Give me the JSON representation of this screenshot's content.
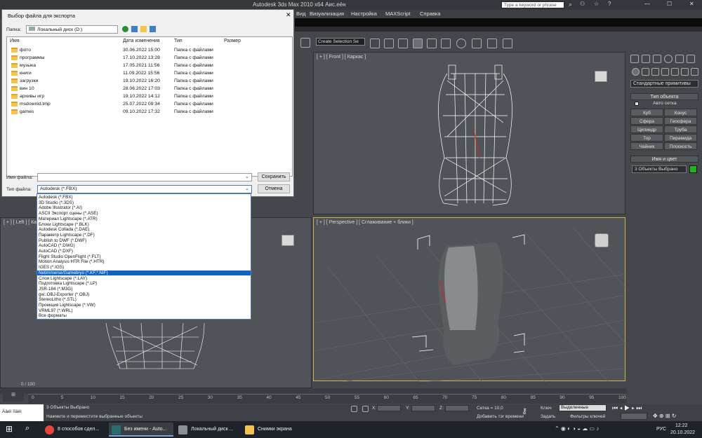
{
  "app": {
    "title": "Autodesk 3ds Max  2010 x64    Аис.еён",
    "search_placeholder": "Type a keyword or phrase",
    "menu": [
      "Вид",
      "Визуализация",
      "Настройка",
      "MAXScript",
      "Справка"
    ],
    "win_controls": [
      "—",
      "☐",
      "✕"
    ]
  },
  "toolbar": {
    "selection_set": "Create Selection Se"
  },
  "viewports": {
    "front": "[ + ] [ Front ] [ Каркас ]",
    "left": "[ + ] [ Left ] [ Кар",
    "perspective": "[ + ] [ Perspective ] [ Сглаживание + блики ]"
  },
  "command_panel": {
    "dropdown": "Стандартные примитивы",
    "object_type_header": "Тип объекта",
    "autogrid_label": "Авто сетка",
    "buttons": [
      "Куб",
      "Конус",
      "Сфера",
      "Геосфера",
      "Цилиндр",
      "Труба",
      "Тор",
      "Пирамида",
      "Чайник",
      "Плоскость"
    ],
    "name_color_header": "Имя и цвет",
    "name_value": "3 Объекты Выбрано",
    "object_color": "#1db41d"
  },
  "dialog": {
    "title": "Выбор файла для экспорта",
    "close": "✕",
    "folder_label": "Папка:",
    "folder_value": "Локальный диск (D:)",
    "columns": [
      "Имя",
      "Дата изменения",
      "Тип",
      "Размер"
    ],
    "files": [
      {
        "name": "фото",
        "date": "30.06.2022 15:00",
        "type": "Папка с файлами"
      },
      {
        "name": "программы",
        "date": "17.10.2022 13:28",
        "type": "Папка с файлами"
      },
      {
        "name": "музыка",
        "date": "17.05.2021 11:56",
        "type": "Папка с файлами"
      },
      {
        "name": "книги",
        "date": "11.09.2022 15:56",
        "type": "Папка с файлами"
      },
      {
        "name": "загрузки",
        "date": "19.10.2022 16:20",
        "type": "Папка с файлами"
      },
      {
        "name": "вин 10",
        "date": "28.06.2022 17:03",
        "type": "Папка с файлами"
      },
      {
        "name": "архивы игр",
        "date": "19.10.2022 14:12",
        "type": "Папка с файлами"
      },
      {
        "name": "msdownld.tmp",
        "date": "25.07.2022 09:34",
        "type": "Папка с файлами"
      },
      {
        "name": "games",
        "date": "09.10.2022 17:32",
        "type": "Папка с файлами"
      }
    ],
    "filename_label": "Имя файла:",
    "filetype_label": "Тип файла:",
    "filetype_value": "Autodesk (*.FBX)",
    "save_button": "Сохранить",
    "cancel_button": "Отмена",
    "filetype_options": [
      "Autodesk (*.FBX)",
      "3D Studio (*.3DS)",
      "Adobe Illustrator (*.AI)",
      "ASCII Экспорт сцены (*.ASE)",
      "Материал Lightscape (*.ATR)",
      "Блоки Lightscape (*.BLK)",
      "Autodesk Collada (*.DAE)",
      "Параметр Lightscape (*.DF)",
      "Publish to DWF (*.DWF)",
      "AutoCAD (*.DWG)",
      "AutoCAD (*.DXF)",
      "Flight Studio OpenFlight (*.FLT)",
      "Motion Analysis HTR File (*.HTR)",
      "IGES (*.IGS)",
      "Netimmerse/Gamebryo (*.KF,*.NIF)",
      "Слои Lightscape (*.LAY)",
      "Подготовка Lightscape (*.LP)",
      "JSR-184 (*.M3G)",
      "gw::OBJ-Exporter (*.OBJ)",
      "StereoLitho (*.STL)",
      "Проекция Lightscape (*.VW)",
      "VRML97 (*.WRL)",
      "Все форматы"
    ],
    "selected_option_index": 14
  },
  "timeline": {
    "frame_display": "0 / 100",
    "ticks": [
      "0",
      "5",
      "10",
      "15",
      "20",
      "25",
      "30",
      "35",
      "40",
      "45",
      "50",
      "55",
      "60",
      "65",
      "70",
      "75",
      "80",
      "85",
      "90",
      "95",
      "100"
    ]
  },
  "status": {
    "script_label": "Ääéì ïîäèì",
    "selected_text": "3 Объекты Выбрано",
    "hint_text": "Нажмите и переместите выбранные объекты",
    "x_label": "X:",
    "y_label": "Y:",
    "z_label": "Z:",
    "grid_text": "Сетка = 10,0",
    "add_tag": "Добавить тэг времени",
    "key_label": "Ключ",
    "key_mode": "Выделенные",
    "set_label": "Задать",
    "filters_label": "Фильтры ключей"
  },
  "taskbar": {
    "items": [
      {
        "label": "8 способов сдел...",
        "color": "#e7463a"
      },
      {
        "label": "Без имени - Auto...",
        "color": "#2a6d6e"
      },
      {
        "label": "Локальный диск ...",
        "color": "#8a8f96"
      },
      {
        "label": "Снимки экрана",
        "color": "#f4c350"
      }
    ],
    "lang": "РУС",
    "time": "12:22",
    "date": "20.10.2022"
  }
}
